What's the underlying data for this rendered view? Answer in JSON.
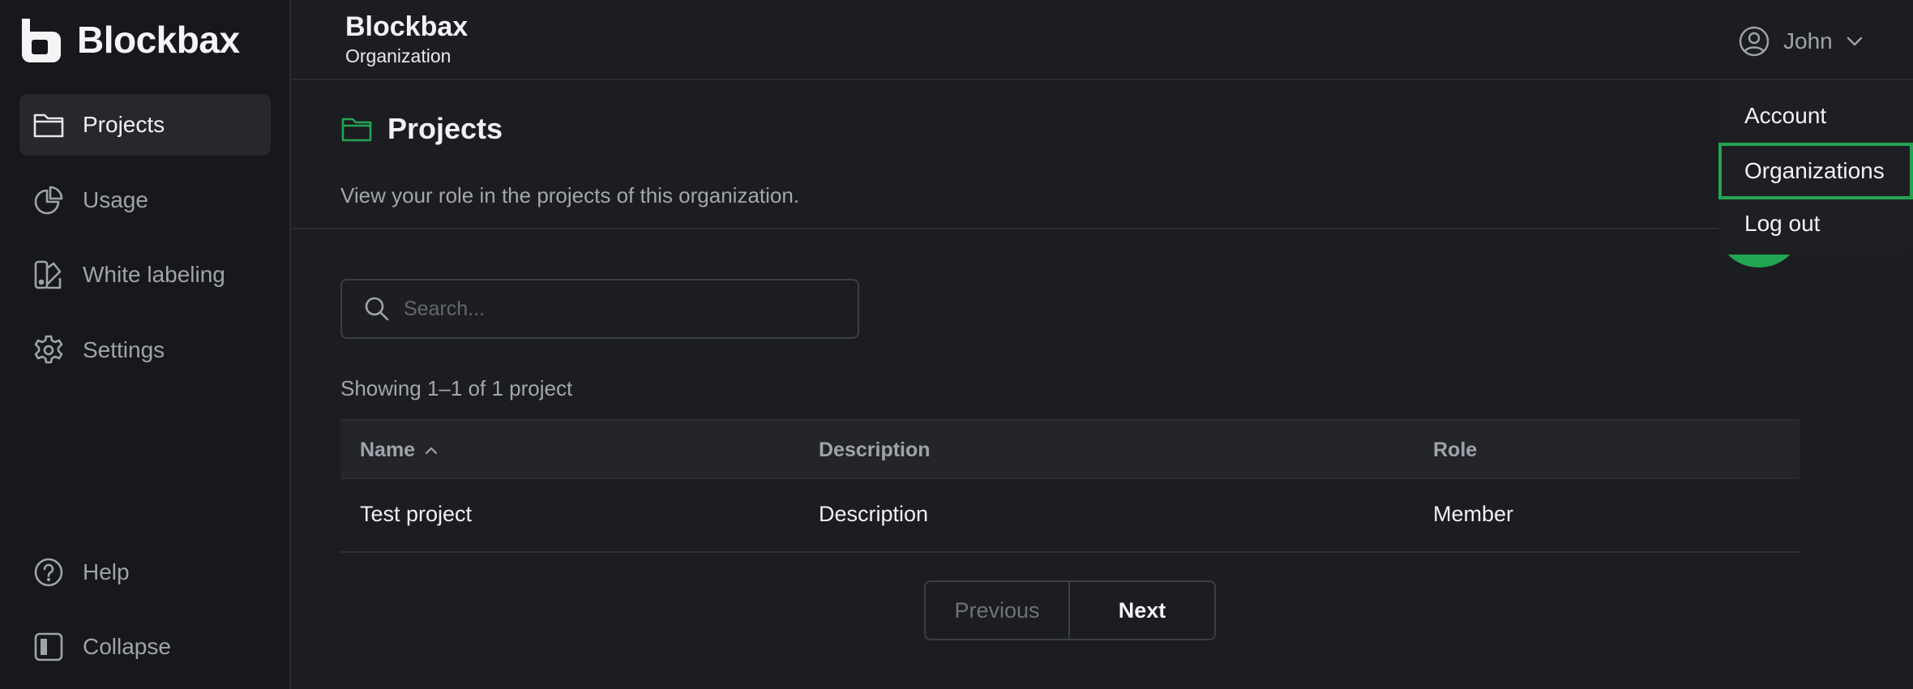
{
  "brand": {
    "name": "Blockbax"
  },
  "sidebar": {
    "items": [
      {
        "label": "Projects",
        "icon": "folder-icon",
        "active": true
      },
      {
        "label": "Usage",
        "icon": "pie-chart-icon"
      },
      {
        "label": "White labeling",
        "icon": "palette-icon"
      },
      {
        "label": "Settings",
        "icon": "gear-icon"
      }
    ],
    "footer": [
      {
        "label": "Help",
        "icon": "help-circle-icon"
      },
      {
        "label": "Collapse",
        "icon": "collapse-sidebar-icon"
      }
    ]
  },
  "header": {
    "title": "Blockbax",
    "subtitle": "Organization"
  },
  "user": {
    "name": "John"
  },
  "user_menu": {
    "items": [
      {
        "label": "Account"
      },
      {
        "label": "Organizations",
        "highlighted": true
      },
      {
        "label": "Log out"
      }
    ]
  },
  "page": {
    "title": "Projects",
    "description": "View your role in the projects of this organization."
  },
  "search": {
    "placeholder": "Search...",
    "value": ""
  },
  "results": {
    "showing": "Showing 1–1 of 1 project"
  },
  "table": {
    "columns": [
      {
        "label": "Name",
        "sort": "ascending"
      },
      {
        "label": "Description"
      },
      {
        "label": "Role"
      }
    ],
    "rows": [
      {
        "name": "Test project",
        "description": "Description",
        "role": "Member"
      }
    ]
  },
  "pagination": {
    "previous": "Previous",
    "next": "Next",
    "previous_disabled": true
  },
  "colors": {
    "accent": "#22a553",
    "background": "#1c1d21",
    "sidebar": "#17181b"
  }
}
